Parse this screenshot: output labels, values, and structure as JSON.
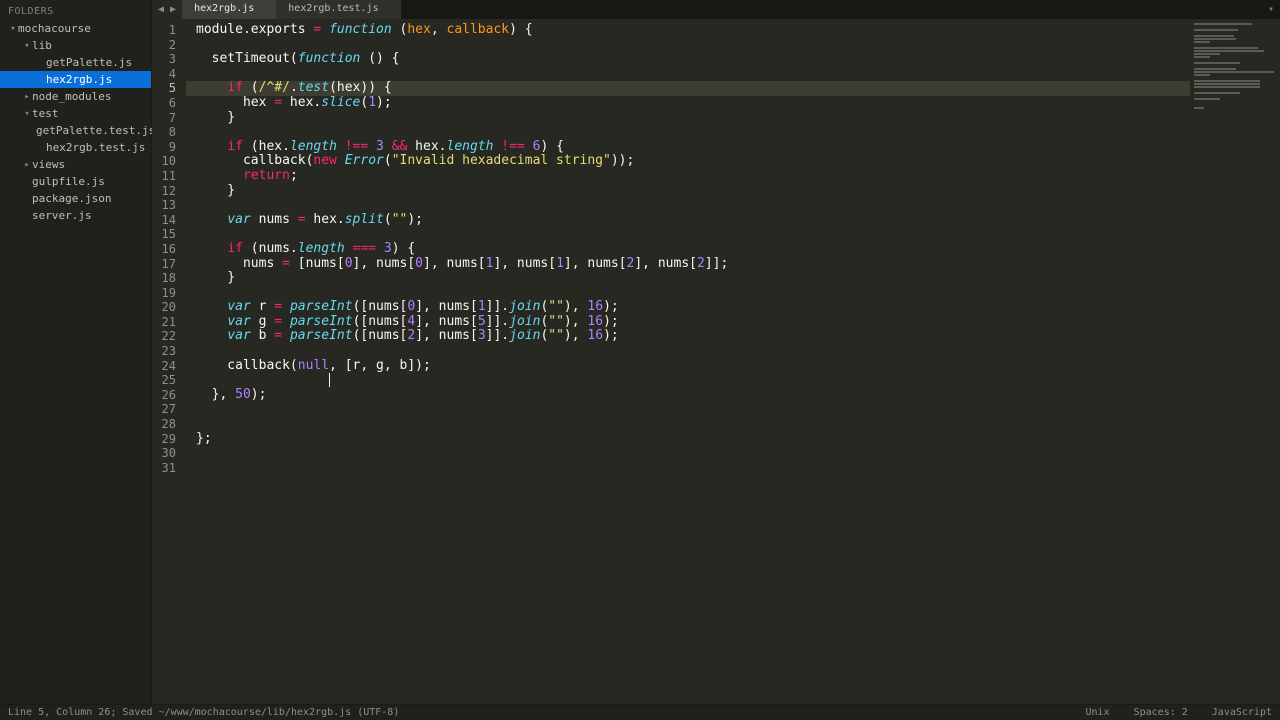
{
  "sidebar": {
    "header": "FOLDERS",
    "tree": [
      {
        "label": "mochacourse",
        "type": "folder",
        "depth": 1,
        "open": true
      },
      {
        "label": "lib",
        "type": "folder",
        "depth": 2,
        "open": true
      },
      {
        "label": "getPalette.js",
        "type": "file",
        "depth": 3
      },
      {
        "label": "hex2rgb.js",
        "type": "file",
        "depth": 3,
        "selected": true
      },
      {
        "label": "node_modules",
        "type": "folder",
        "depth": 2,
        "open": false
      },
      {
        "label": "test",
        "type": "folder",
        "depth": 2,
        "open": true
      },
      {
        "label": "getPalette.test.js",
        "type": "file",
        "depth": 3
      },
      {
        "label": "hex2rgb.test.js",
        "type": "file",
        "depth": 3
      },
      {
        "label": "views",
        "type": "folder",
        "depth": 2,
        "open": false
      },
      {
        "label": "gulpfile.js",
        "type": "file",
        "depth": 2
      },
      {
        "label": "package.json",
        "type": "file",
        "depth": 2
      },
      {
        "label": "server.js",
        "type": "file",
        "depth": 2
      }
    ]
  },
  "tabs": [
    {
      "label": "hex2rgb.js",
      "active": true
    },
    {
      "label": "hex2rgb.test.js",
      "active": false
    }
  ],
  "editor": {
    "line_count": 31,
    "active_line": 5,
    "cursor_indicator": "I"
  },
  "code_lines": [
    [
      [
        "c-p",
        "module"
      ],
      [
        "c-p",
        "."
      ],
      [
        "c-p",
        "exports"
      ],
      [
        "c-p",
        " "
      ],
      [
        "c-k",
        "="
      ],
      [
        "c-p",
        " "
      ],
      [
        "c-f",
        "function"
      ],
      [
        "c-p",
        " ("
      ],
      [
        "c-o",
        "hex"
      ],
      [
        "c-p",
        ", "
      ],
      [
        "c-o",
        "callback"
      ],
      [
        "c-p",
        ") {"
      ]
    ],
    [],
    [
      [
        "c-p",
        "  setTimeout("
      ],
      [
        "c-f",
        "function"
      ],
      [
        "c-p",
        " () {"
      ]
    ],
    [],
    [
      [
        "c-p",
        "    "
      ],
      [
        "c-k",
        "if"
      ],
      [
        "c-p",
        " ("
      ],
      [
        "c-s",
        "/^#/"
      ],
      [
        "c-p",
        "."
      ],
      [
        "c-f",
        "test"
      ],
      [
        "c-p",
        "(hex)) {"
      ]
    ],
    [
      [
        "c-p",
        "      hex "
      ],
      [
        "c-k",
        "="
      ],
      [
        "c-p",
        " hex."
      ],
      [
        "c-f",
        "slice"
      ],
      [
        "c-p",
        "("
      ],
      [
        "c-n",
        "1"
      ],
      [
        "c-p",
        ");"
      ]
    ],
    [
      [
        "c-p",
        "    }"
      ]
    ],
    [],
    [
      [
        "c-p",
        "    "
      ],
      [
        "c-k",
        "if"
      ],
      [
        "c-p",
        " (hex."
      ],
      [
        "c-f",
        "length"
      ],
      [
        "c-p",
        " "
      ],
      [
        "c-k",
        "!=="
      ],
      [
        "c-p",
        " "
      ],
      [
        "c-n",
        "3"
      ],
      [
        "c-p",
        " "
      ],
      [
        "c-k",
        "&&"
      ],
      [
        "c-p",
        " hex."
      ],
      [
        "c-f",
        "length"
      ],
      [
        "c-p",
        " "
      ],
      [
        "c-k",
        "!=="
      ],
      [
        "c-p",
        " "
      ],
      [
        "c-n",
        "6"
      ],
      [
        "c-p",
        ") {"
      ]
    ],
    [
      [
        "c-p",
        "      callback("
      ],
      [
        "c-k",
        "new"
      ],
      [
        "c-p",
        " "
      ],
      [
        "c-f",
        "Error"
      ],
      [
        "c-p",
        "("
      ],
      [
        "c-s",
        "\"Invalid hexadecimal string\""
      ],
      [
        "c-p",
        "));"
      ]
    ],
    [
      [
        "c-p",
        "      "
      ],
      [
        "c-k",
        "return"
      ],
      [
        "c-p",
        ";"
      ]
    ],
    [
      [
        "c-p",
        "    }"
      ]
    ],
    [],
    [
      [
        "c-p",
        "    "
      ],
      [
        "c-f",
        "var"
      ],
      [
        "c-p",
        " nums "
      ],
      [
        "c-k",
        "="
      ],
      [
        "c-p",
        " hex."
      ],
      [
        "c-f",
        "split"
      ],
      [
        "c-p",
        "("
      ],
      [
        "c-s",
        "\"\""
      ],
      [
        "c-p",
        ");"
      ]
    ],
    [],
    [
      [
        "c-p",
        "    "
      ],
      [
        "c-k",
        "if"
      ],
      [
        "c-p",
        " (nums."
      ],
      [
        "c-f",
        "length"
      ],
      [
        "c-p",
        " "
      ],
      [
        "c-k",
        "==="
      ],
      [
        "c-p",
        " "
      ],
      [
        "c-n",
        "3"
      ],
      [
        "c-p",
        ") {"
      ]
    ],
    [
      [
        "c-p",
        "      nums "
      ],
      [
        "c-k",
        "="
      ],
      [
        "c-p",
        " [nums["
      ],
      [
        "c-n",
        "0"
      ],
      [
        "c-p",
        "], nums["
      ],
      [
        "c-n",
        "0"
      ],
      [
        "c-p",
        "], nums["
      ],
      [
        "c-n",
        "1"
      ],
      [
        "c-p",
        "], nums["
      ],
      [
        "c-n",
        "1"
      ],
      [
        "c-p",
        "], nums["
      ],
      [
        "c-n",
        "2"
      ],
      [
        "c-p",
        "], nums["
      ],
      [
        "c-n",
        "2"
      ],
      [
        "c-p",
        "]];"
      ]
    ],
    [
      [
        "c-p",
        "    }"
      ]
    ],
    [],
    [
      [
        "c-p",
        "    "
      ],
      [
        "c-f",
        "var"
      ],
      [
        "c-p",
        " r "
      ],
      [
        "c-k",
        "="
      ],
      [
        "c-p",
        " "
      ],
      [
        "c-f",
        "parseInt"
      ],
      [
        "c-p",
        "([nums["
      ],
      [
        "c-n",
        "0"
      ],
      [
        "c-p",
        "], nums["
      ],
      [
        "c-n",
        "1"
      ],
      [
        "c-p",
        "]]."
      ],
      [
        "c-f",
        "join"
      ],
      [
        "c-p",
        "("
      ],
      [
        "c-s",
        "\"\""
      ],
      [
        "c-p",
        "), "
      ],
      [
        "c-n",
        "16"
      ],
      [
        "c-p",
        ");"
      ]
    ],
    [
      [
        "c-p",
        "    "
      ],
      [
        "c-f",
        "var"
      ],
      [
        "c-p",
        " g "
      ],
      [
        "c-k",
        "="
      ],
      [
        "c-p",
        " "
      ],
      [
        "c-f",
        "parseInt"
      ],
      [
        "c-p",
        "([nums["
      ],
      [
        "c-n",
        "4"
      ],
      [
        "c-p",
        "], nums["
      ],
      [
        "c-n",
        "5"
      ],
      [
        "c-p",
        "]]."
      ],
      [
        "c-f",
        "join"
      ],
      [
        "c-p",
        "("
      ],
      [
        "c-s",
        "\"\""
      ],
      [
        "c-p",
        "), "
      ],
      [
        "c-n",
        "16"
      ],
      [
        "c-p",
        ");"
      ]
    ],
    [
      [
        "c-p",
        "    "
      ],
      [
        "c-f",
        "var"
      ],
      [
        "c-p",
        " b "
      ],
      [
        "c-k",
        "="
      ],
      [
        "c-p",
        " "
      ],
      [
        "c-f",
        "parseInt"
      ],
      [
        "c-p",
        "([nums["
      ],
      [
        "c-n",
        "2"
      ],
      [
        "c-p",
        "], nums["
      ],
      [
        "c-n",
        "3"
      ],
      [
        "c-p",
        "]]."
      ],
      [
        "c-f",
        "join"
      ],
      [
        "c-p",
        "("
      ],
      [
        "c-s",
        "\"\""
      ],
      [
        "c-p",
        "), "
      ],
      [
        "c-n",
        "16"
      ],
      [
        "c-p",
        ");"
      ]
    ],
    [],
    [
      [
        "c-p",
        "    callback("
      ],
      [
        "c-n",
        "null"
      ],
      [
        "c-p",
        ", [r, g, b]);"
      ]
    ],
    [],
    [
      [
        "c-p",
        "  }, "
      ],
      [
        "c-n",
        "50"
      ],
      [
        "c-p",
        ");"
      ]
    ],
    [],
    [],
    [
      [
        "c-p",
        "};"
      ]
    ],
    [],
    []
  ],
  "minimap_widths": [
    58,
    0,
    44,
    0,
    40,
    42,
    16,
    0,
    64,
    70,
    26,
    16,
    0,
    46,
    0,
    42,
    80,
    16,
    0,
    66,
    66,
    66,
    0,
    46,
    0,
    26,
    0,
    0,
    10,
    0,
    0
  ],
  "statusbar": {
    "left": "Line 5, Column 26; Saved ~/www/mochacourse/lib/hex2rgb.js (UTF-8)",
    "right": [
      "Unix",
      "Spaces: 2",
      "JavaScript"
    ]
  }
}
